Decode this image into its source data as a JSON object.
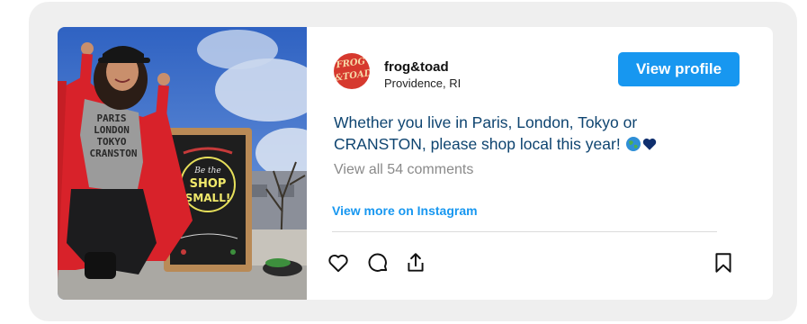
{
  "post": {
    "username": "frog&toad",
    "location": "Providence, RI",
    "avatar_text_line1": "FROG",
    "avatar_text_line2": "&TOAD",
    "view_profile_label": "View profile",
    "caption": "Whether you live in Paris, London, Tokyo or CRANSTON, please shop local this year!",
    "view_comments": "View all 54 comments",
    "view_more_link": "View more on Instagram"
  },
  "photo": {
    "shirt_lines": [
      "PARIS",
      "LONDON",
      "TOKYO",
      "CRANSTON"
    ],
    "board_line1": "Be the",
    "board_line2": "SHOP",
    "board_line3": "SMALL!"
  },
  "icons": {
    "like": "heart-icon",
    "comment": "comment-icon",
    "share": "share-icon",
    "save": "bookmark-icon",
    "emoji_globe": "globe-emoji",
    "emoji_heart": "heart-emoji"
  },
  "colors": {
    "accent": "#1797f0",
    "caption": "#0e4470",
    "muted": "#8a8a8a"
  }
}
